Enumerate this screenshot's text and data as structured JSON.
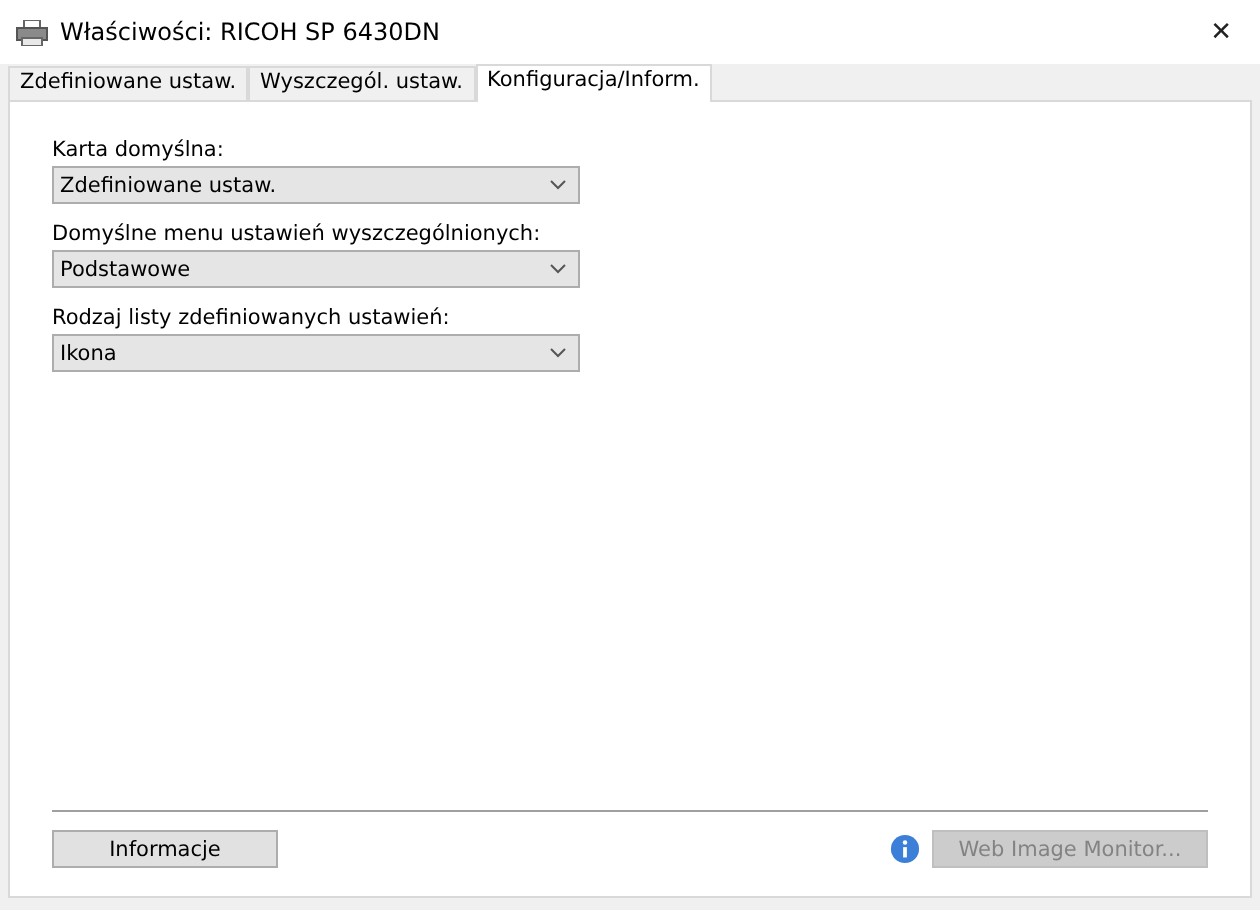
{
  "window": {
    "title": "Właściwości: RICOH SP 6430DN",
    "close": "✕"
  },
  "tabs": [
    {
      "label": "Zdefiniowane ustaw.",
      "selected": false
    },
    {
      "label": "Wyszczegól. ustaw.",
      "selected": false
    },
    {
      "label": "Konfiguracja/Inform.",
      "selected": true
    }
  ],
  "fields": [
    {
      "label": "Karta domyślna:",
      "value": "Zdefiniowane ustaw."
    },
    {
      "label": "Domyślne menu ustawień wyszczególnionych:",
      "value": "Podstawowe"
    },
    {
      "label": "Rodzaj listy zdefiniowanych ustawień:",
      "value": "Ikona"
    }
  ],
  "buttons": [
    {
      "label": "Informacje",
      "disabled": false
    },
    {
      "label": "Web Image Monitor...",
      "disabled": true
    }
  ]
}
